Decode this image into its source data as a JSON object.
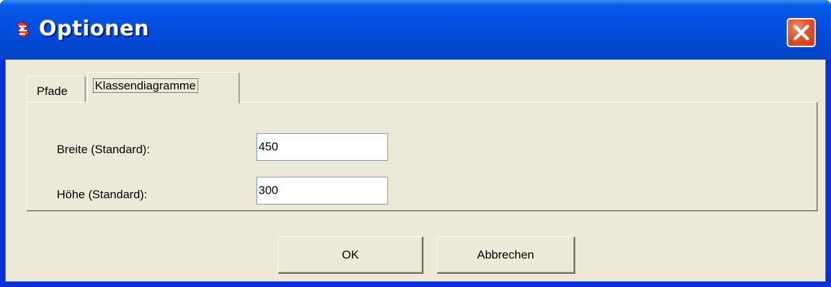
{
  "window": {
    "title": "Optionen"
  },
  "tabs": [
    {
      "label": "Pfade",
      "selected": false
    },
    {
      "label": "Klassendiagramme",
      "selected": true
    }
  ],
  "fields": {
    "width": {
      "label": "Breite (Standard):",
      "value": "450"
    },
    "height": {
      "label": "Höhe (Standard):",
      "value": "300"
    }
  },
  "buttons": {
    "ok": "OK",
    "cancel": "Abbrechen"
  },
  "colors": {
    "titlebar": "#0352e6",
    "face": "#ece9d8",
    "close": "#e2532f"
  },
  "icons": {
    "app": "app-icon",
    "close": "close-icon"
  }
}
